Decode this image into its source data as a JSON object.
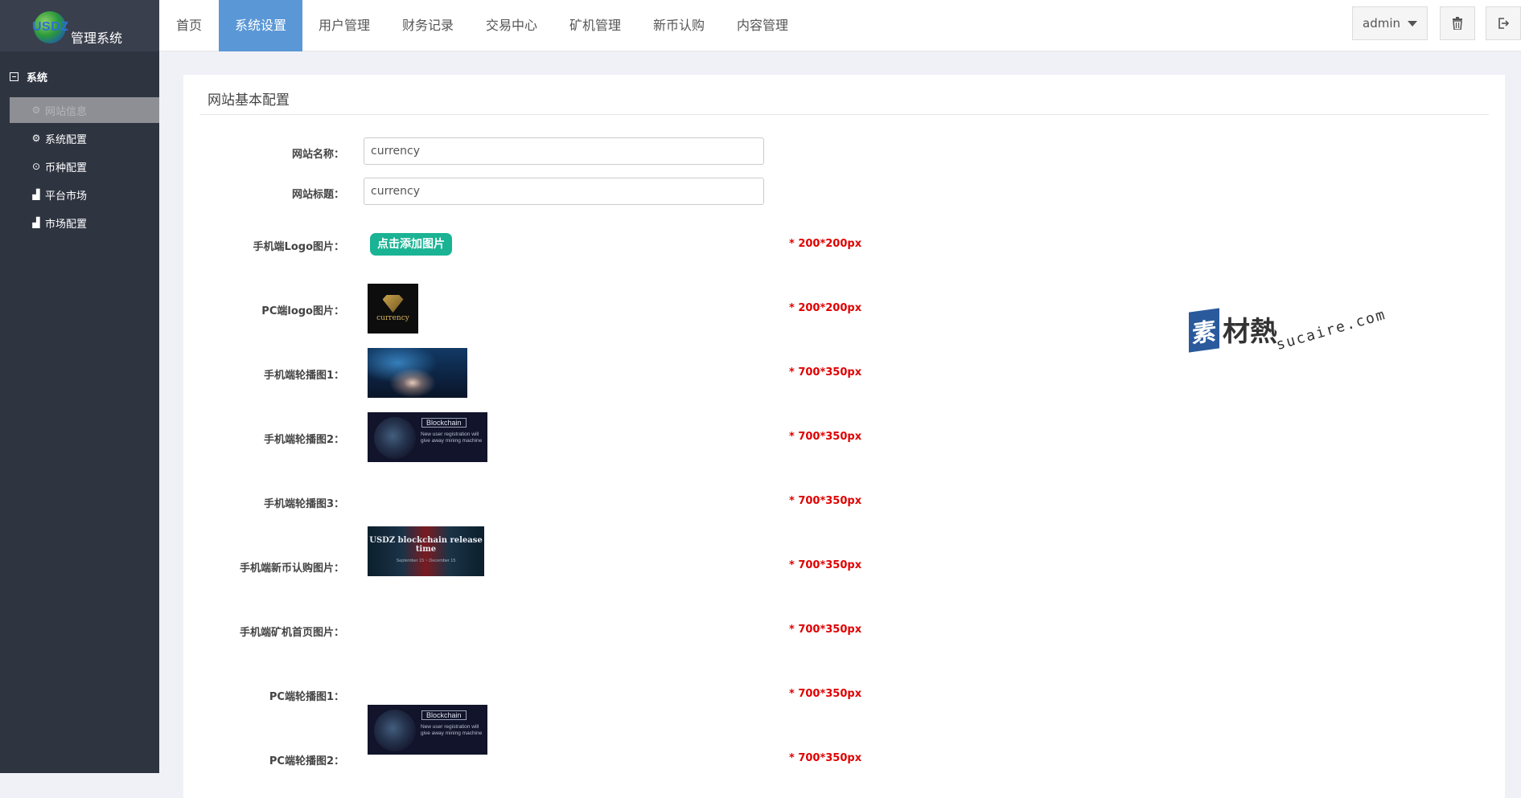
{
  "app": {
    "logo_text": "USDZ",
    "title": "管理系统"
  },
  "sidebar": {
    "section_label": "系统",
    "items": [
      {
        "label": "网站信息",
        "icon": "gear-icon",
        "active": true
      },
      {
        "label": "系统配置",
        "icon": "gear-icon",
        "active": false
      },
      {
        "label": "币种配置",
        "icon": "target-icon",
        "active": false
      },
      {
        "label": "平台市场",
        "icon": "bar-chart-icon",
        "active": false
      },
      {
        "label": "市场配置",
        "icon": "bar-chart-icon",
        "active": false
      }
    ]
  },
  "nav": {
    "tabs": [
      {
        "label": "首页",
        "active": false
      },
      {
        "label": "系统设置",
        "active": true
      },
      {
        "label": "用户管理",
        "active": false
      },
      {
        "label": "财务记录",
        "active": false
      },
      {
        "label": "交易中心",
        "active": false
      },
      {
        "label": "矿机管理",
        "active": false
      },
      {
        "label": "新币认购",
        "active": false
      },
      {
        "label": "内容管理",
        "active": false
      }
    ],
    "user_label": "admin",
    "delete_icon": "trash-icon",
    "logout_icon": "sign-out-icon"
  },
  "panel": {
    "title": "网站基本配置",
    "fields": {
      "site_name": {
        "label": "网站名称：",
        "value": "currency"
      },
      "site_title": {
        "label": "网站标题：",
        "value": "currency"
      },
      "mobile_logo": {
        "label": "手机端Logo图片：",
        "upload_label": "点击添加图片",
        "hint": "* 200*200px"
      },
      "pc_logo": {
        "label": "PC端logo图片：",
        "image_text": "currency",
        "hint": "* 200*200px"
      },
      "mobile_banner1": {
        "label": "手机端轮播图1：",
        "hint": "* 700*350px"
      },
      "mobile_banner2": {
        "label": "手机端轮播图2：",
        "image_title": "Blockchain",
        "image_text": "New user registration will give away mining machine",
        "hint": "* 700*350px"
      },
      "mobile_banner3": {
        "label": "手机端轮播图3：",
        "image_title": "USDZ blockchain release time",
        "image_text": "September 15 ~ December 15",
        "hint": "* 700*350px"
      },
      "mobile_newcoin": {
        "label": "手机端新币认购图片：",
        "hint": "* 700*350px"
      },
      "mobile_miner": {
        "label": "手机端矿机首页图片：",
        "image_title": "Blockchain",
        "image_text": "New user registration will give away mining machine",
        "hint": "* 700*350px"
      },
      "pc_banner1": {
        "label": "PC端轮播图1：",
        "hint": "* 700*350px"
      },
      "pc_banner2": {
        "label": "PC端轮播图2：",
        "hint": "* 700*350px"
      }
    }
  },
  "watermark": {
    "badge": "素",
    "cn": "材熱",
    "en": "sucaire.com"
  },
  "colors": {
    "sidebar_bg": "#2f3441",
    "active_tab": "#5a97d6",
    "upload_button": "#1ab394",
    "hint_red": "#e00000"
  }
}
